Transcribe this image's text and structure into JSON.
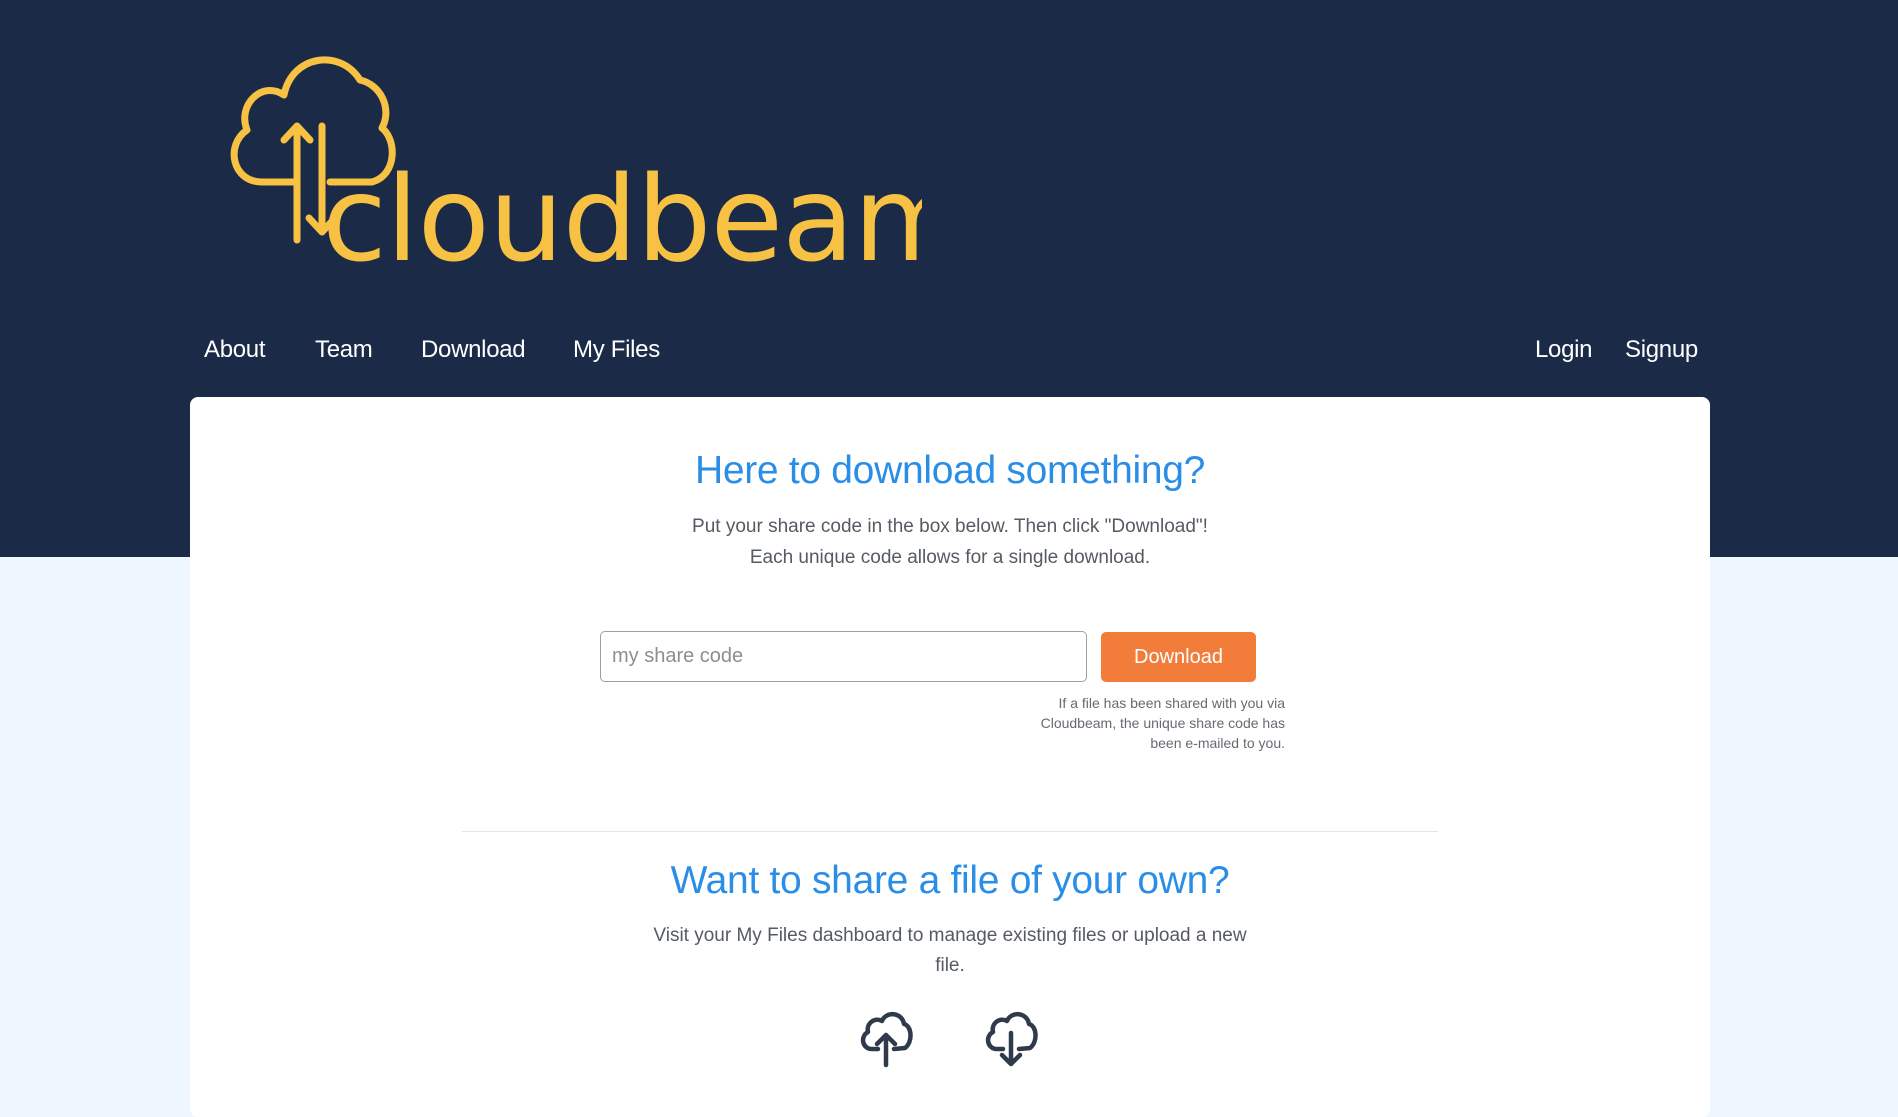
{
  "brand": {
    "name": "cloudbeam",
    "color": "#f7c143",
    "header_bg": "#1b2a47",
    "accent": "#2b8ee6",
    "button_color": "#f27d3b",
    "page_bg": "#eef6ff"
  },
  "nav": {
    "left": [
      "About",
      "Team",
      "Download",
      "My Files"
    ],
    "right": [
      "Login",
      "Signup"
    ]
  },
  "download_section": {
    "title": "Here to download something?",
    "line1": "Put your share code in the box below. Then click \"Download\"!",
    "line2": "Each unique code allows for a single download.",
    "input_placeholder": "my share code",
    "input_value": "",
    "button_label": "Download",
    "hint": "If a file has been shared with you via Cloudbeam, the unique share code has been e-mailed to you."
  },
  "share_section": {
    "title": "Want to share a file of your own?",
    "text": "Visit your My Files dashboard to manage existing files or upload a new file.",
    "icons": [
      "cloud-upload-icon",
      "cloud-download-icon"
    ]
  }
}
